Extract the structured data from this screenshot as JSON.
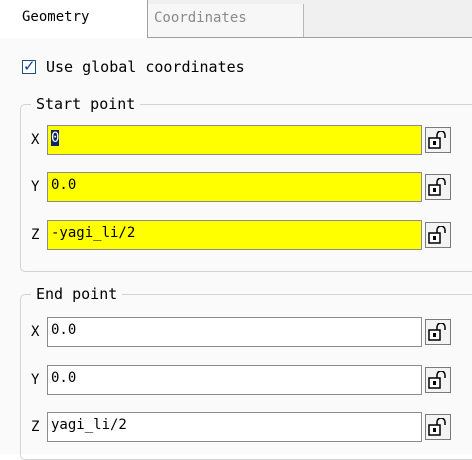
{
  "tabs": [
    {
      "label": "Geometry",
      "active": true
    },
    {
      "label": "Coordinates",
      "active": false
    }
  ],
  "use_global": {
    "label": "Use global coordinates",
    "checked": true
  },
  "start_point": {
    "legend": "Start point",
    "fields": [
      {
        "axis": "X",
        "value": "0",
        "highlight": "#ffff00"
      },
      {
        "axis": "Y",
        "value": "0.0",
        "highlight": "#ffff00"
      },
      {
        "axis": "Z",
        "value": "-yagi_li/2",
        "highlight": "#ffff00"
      }
    ]
  },
  "end_point": {
    "legend": "End point",
    "fields": [
      {
        "axis": "X",
        "value": "0.0"
      },
      {
        "axis": "Y",
        "value": "0.0"
      },
      {
        "axis": "Z",
        "value": "yagi_li/2"
      }
    ]
  },
  "icons": {
    "lock": "unlock-icon",
    "check": "checkmark-icon"
  }
}
